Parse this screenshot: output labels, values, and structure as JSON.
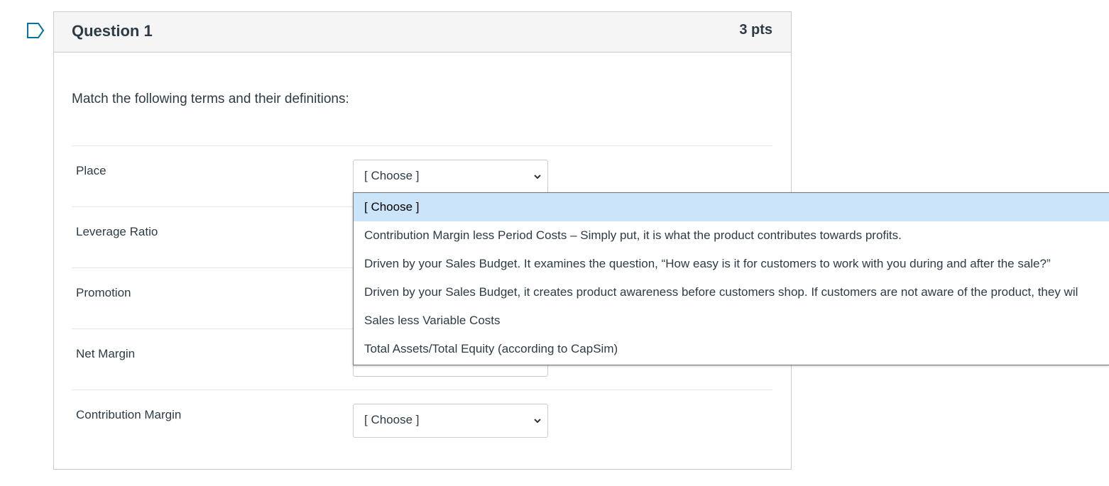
{
  "question": {
    "title": "Question 1",
    "points": "3 pts",
    "prompt": "Match the following terms and their definitions:"
  },
  "rows": [
    {
      "term": "Place",
      "selected": "[ Choose ]"
    },
    {
      "term": "Leverage Ratio",
      "selected": ""
    },
    {
      "term": "Promotion",
      "selected": ""
    },
    {
      "term": "Net Margin",
      "selected": ""
    },
    {
      "term": "Contribution Margin",
      "selected": "[ Choose ]"
    }
  ],
  "dropdown": {
    "options": [
      "[ Choose ]",
      "Contribution Margin less Period Costs – Simply put, it is what the product contributes towards profits.",
      "Driven by your Sales Budget. It examines the question, “How easy is it for customers to work with you during and after the sale?”",
      "Driven by your Sales Budget, it creates product awareness before customers shop. If customers are not aware of the product, they wil",
      "Sales less Variable Costs",
      "Total Assets/Total Equity (according to CapSim)"
    ],
    "highlighted_index": 0
  },
  "colors": {
    "accent": "#0770a3",
    "highlight": "#cce4f9",
    "border": "#c7cdd1",
    "text": "#2d3b45"
  }
}
